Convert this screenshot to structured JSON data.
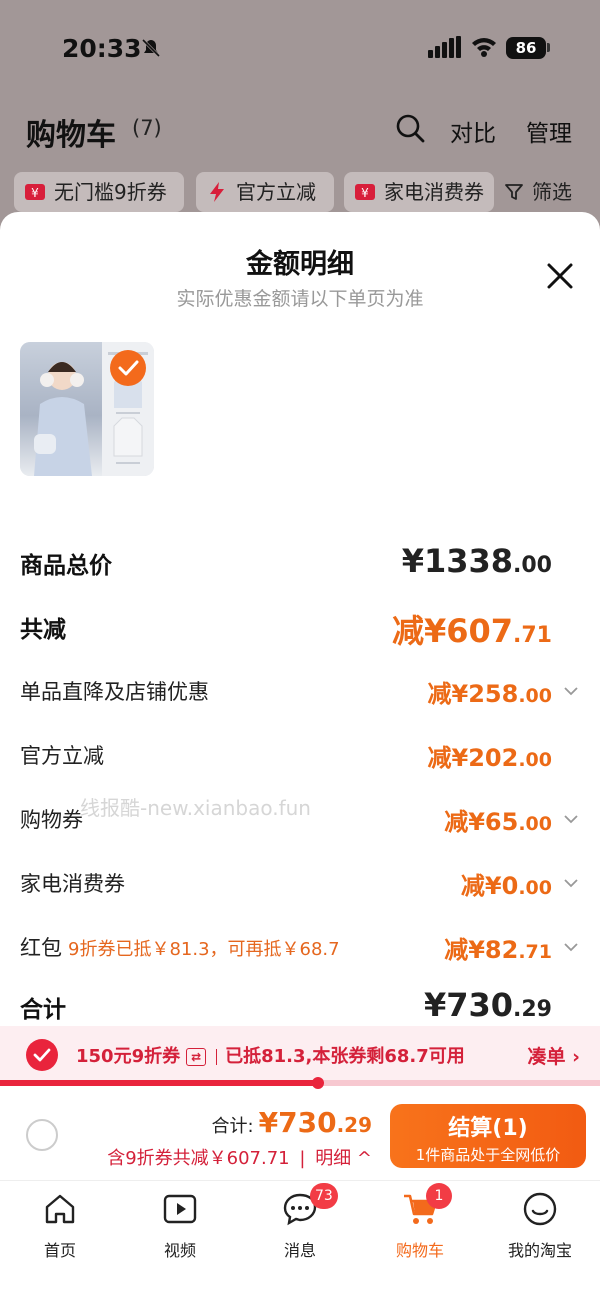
{
  "status": {
    "time": "20:33",
    "battery": "86"
  },
  "header": {
    "title": "购物车",
    "count": "(7)",
    "compare": "对比",
    "manage": "管理"
  },
  "filters": [
    {
      "label": "无门槛9折券"
    },
    {
      "label": "官方立减"
    },
    {
      "label": "家电消费券"
    }
  ],
  "filter_btn": "筛选",
  "sheet": {
    "title": "金额明细",
    "subtitle": "实际优惠金额请以下单页为准",
    "rows": [
      {
        "label": "商品总价",
        "value": "¥1338",
        "cents": ".00"
      },
      {
        "label": "共减",
        "value": "减¥607",
        "cents": ".71"
      },
      {
        "label": "单品直降及店铺优惠",
        "value": "减¥258",
        "cents": ".00"
      },
      {
        "label": "官方立减",
        "value": "减¥202",
        "cents": ".00"
      },
      {
        "label": "购物券",
        "value": "减¥65",
        "cents": ".00"
      },
      {
        "label": "家电消费券",
        "value": "减¥0",
        "cents": ".00"
      },
      {
        "label": "红包",
        "note": "9折券已抵￥81.3，可再抵￥68.7",
        "value": "减¥82",
        "cents": ".71"
      },
      {
        "label": "合计",
        "value": "¥730",
        "cents": ".29"
      }
    ]
  },
  "watermark": "线报酷-new.xianbao.fun",
  "coupon": {
    "name": "150元9折券",
    "status": "已抵81.3,本张券剩68.7可用",
    "action": "凑单",
    "progress": 0.53
  },
  "checkout": {
    "total_label": "合计:",
    "total": "¥730",
    "total_cents": ".29",
    "saving": "含9折券共减￥607.71",
    "detail": "明细",
    "pay_label": "结算(1)",
    "pay_sub": "1件商品处于全网低价"
  },
  "tabs": [
    {
      "label": "首页",
      "icon": "home-icon"
    },
    {
      "label": "视频",
      "icon": "video-icon"
    },
    {
      "label": "消息",
      "icon": "message-icon",
      "badge": "73"
    },
    {
      "label": "购物车",
      "icon": "cart-icon",
      "badge": "1",
      "active": true
    },
    {
      "label": "我的淘宝",
      "icon": "profile-icon"
    }
  ],
  "colors": {
    "accent": "#f36a1c",
    "discount": "#ec6a16",
    "coupon_red": "#e9243c"
  }
}
